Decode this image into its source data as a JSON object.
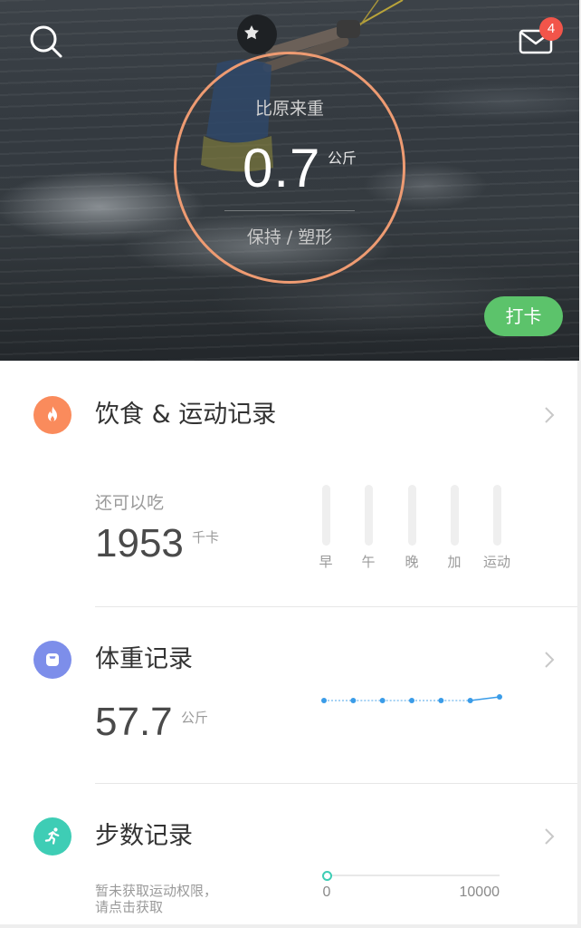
{
  "hero": {
    "search_icon": "search-icon",
    "mail_icon": "mail-icon",
    "mail_badge": "4",
    "ring": {
      "caption": "比原来重",
      "value": "0.7",
      "unit": "公斤",
      "goal": "保持 / 塑形"
    },
    "checkin_label": "打卡"
  },
  "cards": {
    "chevron_icon": "chevron-right-icon",
    "diet": {
      "icon": "fire-icon",
      "title": "饮食 & 运动记录",
      "remaining_label": "还可以吃",
      "remaining_value": "1953",
      "remaining_unit": "千卡",
      "bars": [
        {
          "label": "早",
          "fill": 0
        },
        {
          "label": "午",
          "fill": 0
        },
        {
          "label": "晚",
          "fill": 0
        },
        {
          "label": "加",
          "fill": 0
        },
        {
          "label": "运动",
          "fill": 0
        }
      ]
    },
    "weight": {
      "icon": "scale-icon",
      "title": "体重记录",
      "value": "57.7",
      "unit": "公斤",
      "trend_levels": [
        0,
        0,
        0,
        0,
        0,
        0,
        1
      ]
    },
    "steps": {
      "icon": "runner-icon",
      "title": "步数记录",
      "notice_line1": "暂未获取运动权限，",
      "notice_line2": "请点击获取",
      "range_min": "0",
      "range_max": "10000",
      "progress": 0
    }
  },
  "colors": {
    "ring": "#EE9B72",
    "badge": "#F2554A",
    "checkin": "#5CC36B",
    "diet_accent": "#FA8B5C",
    "weight_accent": "#7D8EEA",
    "steps_accent": "#3ECDB5",
    "trend_line": "#3A9CE8"
  }
}
